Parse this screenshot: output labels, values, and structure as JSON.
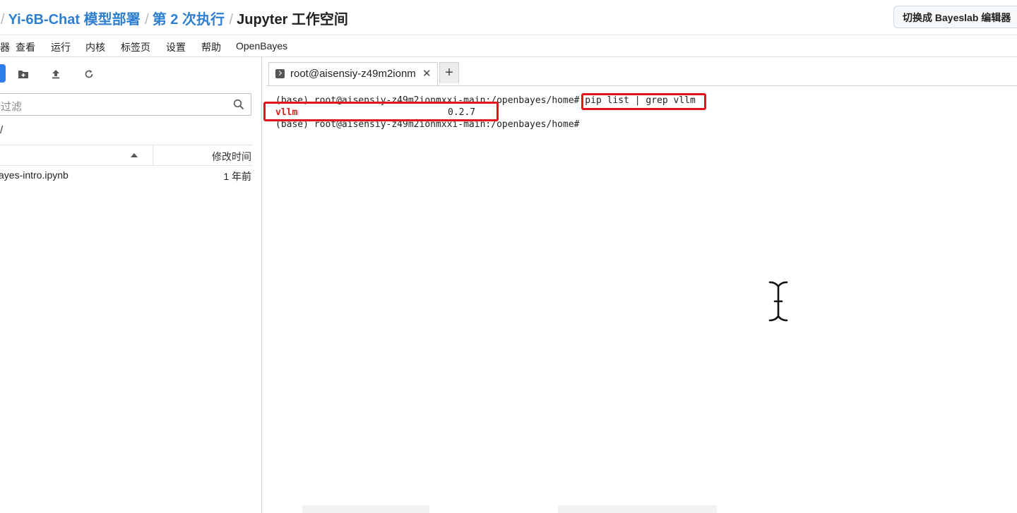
{
  "header": {
    "breadcrumb": [
      {
        "label": "Yi-6B-Chat 模型部署",
        "type": "link"
      },
      {
        "label": "第 2 次执行",
        "type": "link"
      },
      {
        "label": "Jupyter 工作空间",
        "type": "current"
      }
    ],
    "switch_button": "切换成 Bayeslab 编辑器"
  },
  "menu": {
    "items": [
      "查看",
      "运行",
      "内核",
      "标签页",
      "设置",
      "帮助",
      "OpenBayes"
    ]
  },
  "file_browser": {
    "filter_placeholder": "过滤",
    "path": "/",
    "columns": {
      "modified": "修改时间"
    },
    "files": [
      {
        "name": "ayes-intro.ipynb",
        "modified": "1 年前"
      }
    ]
  },
  "terminal_tab": {
    "label": "root@aisensiy-z49m2ionm",
    "close": "✕",
    "add": "+"
  },
  "terminal": {
    "lines": [
      {
        "prompt": "(base) root@aisensiy-z49m2ionmxxi-main:/openbayes/home#",
        "command": " pip list | grep vllm"
      },
      {
        "package": "vllm",
        "version": "0.2.7"
      },
      {
        "prompt": "(base) root@aisensiy-z49m2ionmxxi-main:/openbayes/home#",
        "command": ""
      }
    ]
  },
  "colors": {
    "accent": "#2b7de9",
    "link": "#2f7fd1",
    "highlight": "#e3141b"
  },
  "icons": [
    "new-folder-icon",
    "upload-icon",
    "refresh-icon",
    "search-icon",
    "sort-asc-icon",
    "terminal-icon",
    "text-cursor-icon"
  ]
}
